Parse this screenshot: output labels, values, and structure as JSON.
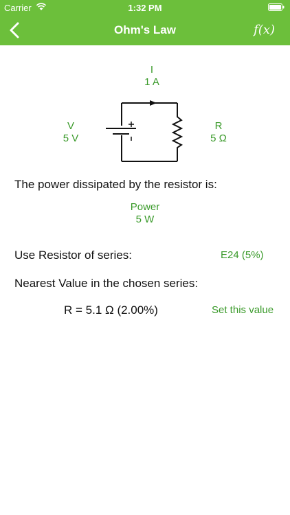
{
  "status_bar": {
    "carrier": "Carrier",
    "time": "1:32 PM"
  },
  "nav": {
    "title": "Ohm's Law",
    "fx_label": "f(x)"
  },
  "current": {
    "symbol": "I",
    "value": "1 A"
  },
  "voltage": {
    "symbol": "V",
    "value": "5 V"
  },
  "resistance": {
    "symbol": "R",
    "value": "5 Ω"
  },
  "power_statement": "The power dissipated by the resistor is:",
  "power": {
    "label": "Power",
    "value": "5 W"
  },
  "series": {
    "label": "Use Resistor of series:",
    "value": "E24 (5%)"
  },
  "nearest": {
    "label": "Nearest Value in the chosen series:",
    "value": "R = 5.1 Ω (2.00%)",
    "action": "Set this value"
  },
  "colors": {
    "accent": "#6cbf3b",
    "value_text": "#3a9a2a"
  }
}
